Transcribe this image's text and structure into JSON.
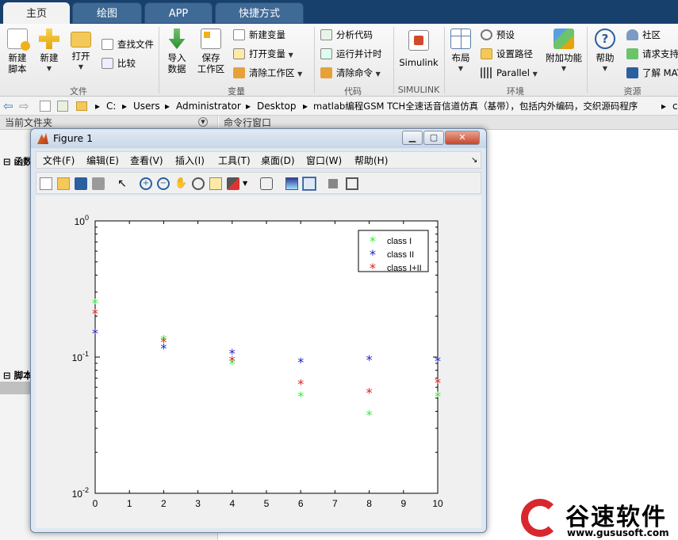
{
  "tabs": [
    "主页",
    "绘图",
    "APP",
    "快捷方式"
  ],
  "ribbon": {
    "file_group": {
      "title": "文件",
      "new_script": "新建\n脚本",
      "new": "新建",
      "open": "打开",
      "find_files": "查找文件",
      "compare": "比较"
    },
    "variable_group": {
      "title": "变量",
      "import_data": "导入\n数据",
      "save_workspace": "保存\n工作区",
      "new_variable": "新建变量",
      "open_variable": "打开变量",
      "clear_workspace": "清除工作区"
    },
    "code_group": {
      "title": "代码",
      "analyze_code": "分析代码",
      "run_and_time": "运行并计时",
      "clear_commands": "清除命令"
    },
    "simulink_group": {
      "title": "SIMULINK",
      "simulink": "Simulink"
    },
    "environment_group": {
      "title": "环境",
      "layout": "布局",
      "preferences": "预设",
      "set_path": "设置路径",
      "parallel": "Parallel",
      "add_ons": "附加功能"
    },
    "resources_group": {
      "title": "资源",
      "help": "帮助",
      "community": "社区",
      "request_support": "请求支持",
      "learn_matlab": "了解 MAT"
    }
  },
  "address_bar": {
    "path_parts": [
      "C:",
      "Users",
      "Administrator",
      "Desktop",
      "matlab编程GSM TCH全速话音信道仿真（基带），包括内外编码，交织源码程序",
      "c"
    ]
  },
  "left_panel": {
    "header": "当前文件夹",
    "section1": "函数",
    "section2": "脚本"
  },
  "command_panel": {
    "header": "命令行窗口"
  },
  "figure": {
    "title": "Figure 1",
    "menu": [
      "文件(F)",
      "编辑(E)",
      "查看(V)",
      "插入(I)",
      "工具(T)",
      "桌面(D)",
      "窗口(W)",
      "帮助(H)"
    ],
    "toolbar_icons": [
      "new-figure-icon",
      "open-icon",
      "save-icon",
      "print-icon",
      "pointer-icon",
      "zoom-in-icon",
      "zoom-out-icon",
      "pan-icon",
      "rotate-icon",
      "data-cursor-icon",
      "brush-icon",
      "link-icon",
      "colorbar-icon",
      "legend-icon",
      "hide-icon",
      "dock-icon"
    ]
  },
  "colors": {
    "class1": "#33ee33",
    "class2": "#1a1acc",
    "class12": "#e01818",
    "titlebar": "#17406d"
  },
  "chart_data": {
    "type": "scatter",
    "title": "",
    "xlabel": "",
    "ylabel": "",
    "xlim": [
      0,
      10
    ],
    "ylim_log10": [
      -2,
      0
    ],
    "yscale": "log",
    "xticks": [
      "0",
      "1",
      "2",
      "3",
      "4",
      "5",
      "6",
      "7",
      "8",
      "9",
      "10"
    ],
    "yticks": [
      {
        "base": "10",
        "exp": "0"
      },
      {
        "base": "10",
        "exp": "-1"
      },
      {
        "base": "10",
        "exp": "-2"
      }
    ],
    "legend_position": "top-right",
    "marker": "*",
    "series": [
      {
        "name": "class I",
        "x": [
          0,
          2,
          4,
          6,
          8,
          10
        ],
        "y": [
          0.25,
          0.135,
          0.09,
          0.052,
          0.038,
          0.052
        ]
      },
      {
        "name": "class II",
        "x": [
          0,
          2,
          4,
          6,
          8,
          10
        ],
        "y": [
          0.15,
          0.117,
          0.107,
          0.092,
          0.096,
          0.094
        ]
      },
      {
        "name": "class I+II",
        "x": [
          0,
          2,
          4,
          6,
          8,
          10
        ],
        "y": [
          0.21,
          0.13,
          0.095,
          0.064,
          0.055,
          0.065
        ]
      }
    ]
  },
  "watermark": {
    "name": "谷速软件",
    "url": "www.gususoft.com"
  }
}
